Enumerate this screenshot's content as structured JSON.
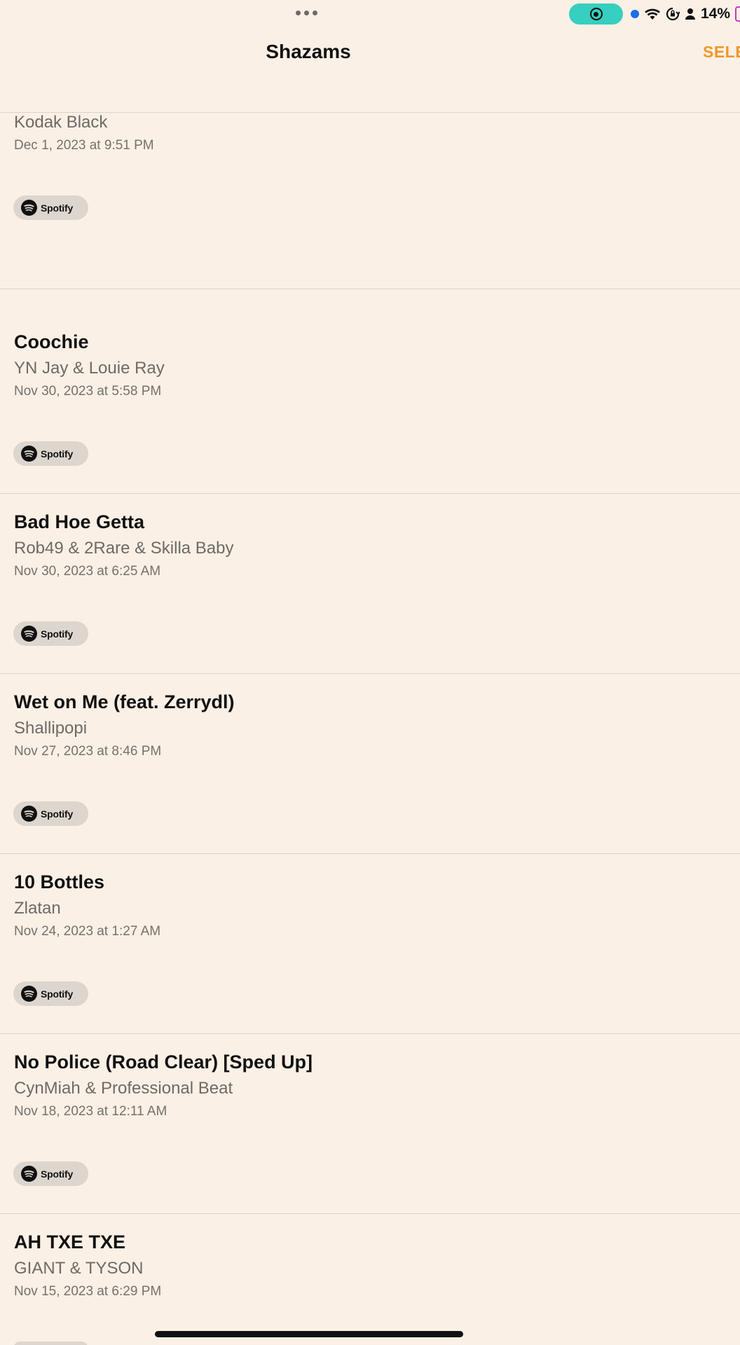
{
  "status_bar": {
    "battery_text": "14%",
    "record_color": "#36cfc0",
    "camera_dot_color": "#1a6ee8"
  },
  "header": {
    "title": "Shazams",
    "select_label": "SELE",
    "accent_color": "#f0982a"
  },
  "songs": [
    {
      "title": "",
      "artist": "Kodak Black",
      "date": "Dec 1, 2023 at 9:51 PM",
      "service": "Spotify"
    },
    {
      "title": "Coochie",
      "artist": "YN Jay & Louie Ray",
      "date": "Nov 30, 2023 at 5:58 PM",
      "service": "Spotify"
    },
    {
      "title": "Bad Hoe Getta",
      "artist": "Rob49 & 2Rare & Skilla Baby",
      "date": "Nov 30, 2023 at 6:25 AM",
      "service": "Spotify"
    },
    {
      "title": "Wet on Me (feat. Zerrydl)",
      "artist": "Shallipopi",
      "date": "Nov 27, 2023 at 8:46 PM",
      "service": "Spotify"
    },
    {
      "title": "10 Bottles",
      "artist": "Zlatan",
      "date": "Nov 24, 2023 at 1:27 AM",
      "service": "Spotify"
    },
    {
      "title": "No Police (Road Clear) [Sped Up]",
      "artist": "CynMiah & Professional Beat",
      "date": "Nov 18, 2023 at 12:11 AM",
      "service": "Spotify"
    },
    {
      "title": "AH TXE TXE",
      "artist": "GIANT & TYSON",
      "date": "Nov 15, 2023 at 6:29 PM",
      "service": ""
    }
  ],
  "icons": [
    "multitask-dots-icon",
    "screen-record-icon",
    "camera-indicator-icon",
    "wifi-icon",
    "orientation-lock-icon",
    "person-icon",
    "battery-icon",
    "spotify-icon"
  ]
}
